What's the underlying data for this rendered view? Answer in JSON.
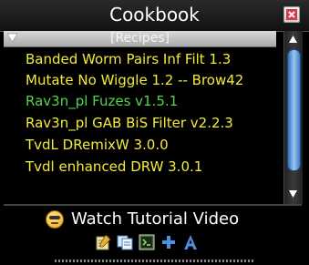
{
  "window": {
    "title": "Cookbook"
  },
  "list": {
    "header": "[Recipes]",
    "items": [
      {
        "label": "Banded Worm Pairs Inf Filt 1.3",
        "color": "#f4ec3a"
      },
      {
        "label": "Mutate No Wiggle 1.2 -- Brow42",
        "color": "#f4ec3a"
      },
      {
        "label": "Rav3n_pl Fuzes  v1.5.1",
        "color": "#55d34d"
      },
      {
        "label": "Rav3n_pl GAB BiS Filter v2.2.3",
        "color": "#f4ec3a"
      },
      {
        "label": "TvdL DRemixW 3.0.0",
        "color": "#f4ec3a"
      },
      {
        "label": "Tvdl enhanced DRW 3.0.1",
        "color": "#f4ec3a"
      }
    ]
  },
  "tutorial": {
    "label": "Watch Tutorial Video"
  },
  "toolbar": {
    "icons": [
      "edit-recipe-icon",
      "copy-recipe-icon",
      "script-console-icon",
      "add-icon",
      "font-icon"
    ]
  }
}
